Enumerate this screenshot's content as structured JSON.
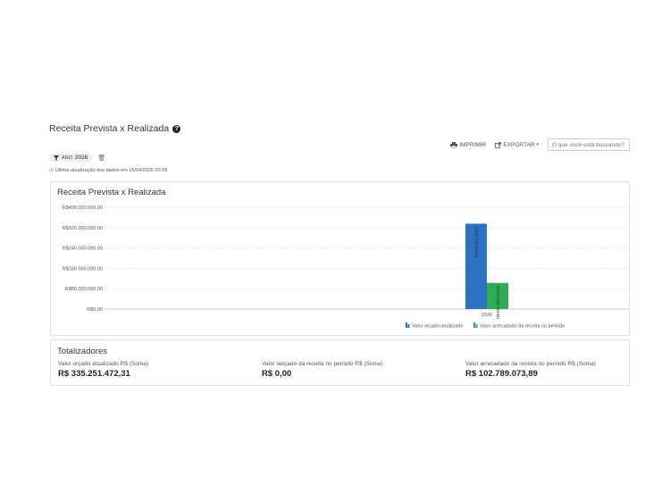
{
  "page": {
    "title": "Receita Prevista x Realizada"
  },
  "toolbar": {
    "print_label": "IMPRIMIR",
    "export_label": "EXPORTAR",
    "search_placeholder": "O que você está buscando?"
  },
  "filter": {
    "label": "ANO",
    "value": "2026"
  },
  "update_text": "Última atualização dos dados em 15/04/2026 20:28",
  "chart_data": {
    "type": "bar",
    "title": "Receita Prevista x Realizada",
    "categories": [
      "2026"
    ],
    "series": [
      {
        "name": "Valor orçado atualizado",
        "values": [
          335251472.31
        ],
        "label": "R$335.251.472,3",
        "color": "#2a72c5"
      },
      {
        "name": "Valor arrecadado da receita no período",
        "values": [
          102789073.89
        ],
        "label": "R$102.789.073,89",
        "color": "#2eac55"
      }
    ],
    "ylim": [
      0,
      400000000
    ],
    "yticks": [
      "R$0,00",
      "R$80.000.000,00",
      "R$160.000.000,00",
      "R$240.000.000,00",
      "R$320.000.000,00",
      "R$400.000.000,00"
    ],
    "ytick_values": [
      0,
      80000000,
      160000000,
      240000000,
      320000000,
      400000000
    ],
    "grid": true,
    "legend": "bottom-right"
  },
  "totals": {
    "title": "Totalizadores",
    "items": [
      {
        "label": "Valor orçado atualizado R$ (Soma)",
        "value": "R$ 335.251.472,31"
      },
      {
        "label": "Valor lançado da receita no período R$ (Soma)",
        "value": "R$ 0,00"
      },
      {
        "label": "Valor arrecadado da receita no período R$ (Soma)",
        "value": "R$ 102.789.073,89"
      }
    ]
  }
}
